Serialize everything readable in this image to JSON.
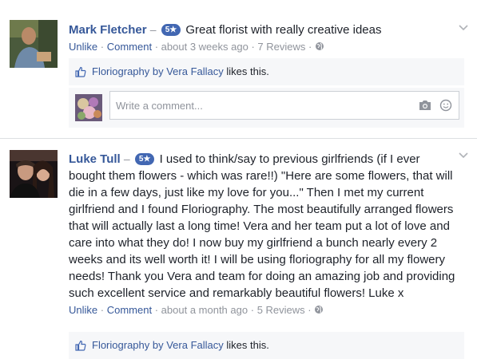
{
  "reviews": [
    {
      "author": "Mark Fletcher",
      "rating_badge": "5★",
      "text": "Great florist with really creative ideas",
      "actions": {
        "unlike": "Unlike",
        "comment": "Comment"
      },
      "time": "about 3 weeks ago",
      "review_count": "7 Reviews",
      "likes": {
        "page_name": "Floriography by Vera Fallacy",
        "suffix": " likes this."
      },
      "comment_placeholder": "Write a comment..."
    },
    {
      "author": "Luke Tull",
      "rating_badge": "5★",
      "text": "I used to think/say to previous girlfriends (if I ever bought them flowers - which was rare!!) \"Here are some flowers, that will die in a few days, just like my love for you...\" Then I met my current girlfriend and I found Floriography. The most beautifully arranged flowers that will actually last a long time! Vera and her team put a lot of love and care into what they do! I now buy my girlfriend a bunch nearly every 2 weeks and its well worth it! I will be using floriography for all my flowery needs! Thank you Vera and team for doing an amazing job and providing such excellent service and remarkably beautiful flowers! Luke x",
      "actions": {
        "unlike": "Unlike",
        "comment": "Comment"
      },
      "time": "about a month ago",
      "review_count": "5 Reviews",
      "likes": {
        "page_name": "Floriography by Vera Fallacy",
        "suffix": " likes this."
      }
    }
  ],
  "icons": {
    "privacy": "globe-icon",
    "like": "thumbs-up-icon",
    "camera": "camera-icon",
    "emoji": "smiley-icon",
    "menu": "chevron-down-icon"
  },
  "colors": {
    "link": "#365899",
    "badge": "#4267b2",
    "muted": "#90949c",
    "panel": "#f6f7f9"
  }
}
